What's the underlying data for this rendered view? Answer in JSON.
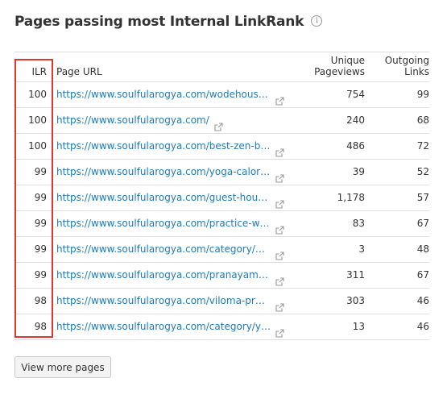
{
  "title": "Pages passing most Internal LinkRank",
  "table": {
    "headers": {
      "ilr": "ILR",
      "page_url": "Page URL",
      "pageviews_line1": "Unique",
      "pageviews_line2": "Pageviews",
      "links_line1": "Outgoing",
      "links_line2": "Links"
    },
    "rows": [
      {
        "ilr": "100",
        "url": "https://www.soulfularogya.com/wodehouse-q...",
        "pageviews": "754",
        "links": "99"
      },
      {
        "ilr": "100",
        "url": "https://www.soulfularogya.com/",
        "pageviews": "240",
        "links": "68"
      },
      {
        "ilr": "100",
        "url": "https://www.soulfularogya.com/best-zen-books/",
        "pageviews": "486",
        "links": "72"
      },
      {
        "ilr": "99",
        "url": "https://www.soulfularogya.com/yoga-calories-...",
        "pageviews": "39",
        "links": "52"
      },
      {
        "ilr": "99",
        "url": "https://www.soulfularogya.com/guest-house-p...",
        "pageviews": "1,178",
        "links": "57"
      },
      {
        "ilr": "99",
        "url": "https://www.soulfularogya.com/practice-walki...",
        "pageviews": "83",
        "links": "67"
      },
      {
        "ilr": "99",
        "url": "https://www.soulfularogya.com/category/heal...",
        "pageviews": "3",
        "links": "48"
      },
      {
        "ilr": "99",
        "url": "https://www.soulfularogya.com/pranayama-br...",
        "pageviews": "311",
        "links": "67"
      },
      {
        "ilr": "98",
        "url": "https://www.soulfularogya.com/viloma-pranay...",
        "pageviews": "303",
        "links": "46"
      },
      {
        "ilr": "98",
        "url": "https://www.soulfularogya.com/category/yoga/",
        "pageviews": "13",
        "links": "46"
      }
    ]
  },
  "view_more_label": "View more pages",
  "icons": {
    "info": "info-icon",
    "external": "external-link-icon"
  },
  "colors": {
    "link": "#1a7dbf",
    "highlight": "#d93a2b"
  }
}
